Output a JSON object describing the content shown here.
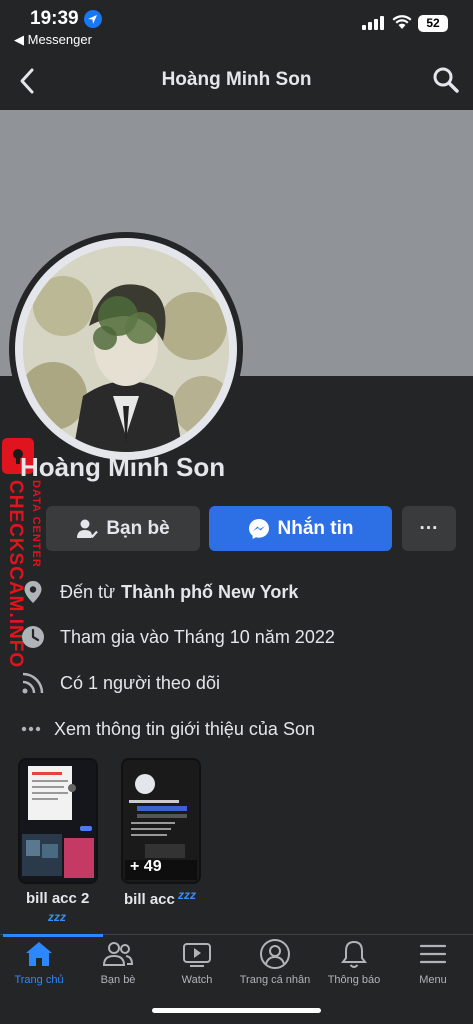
{
  "status_bar": {
    "time": "19:39",
    "back_app": "◀ Messenger",
    "battery": "52"
  },
  "nav": {
    "title": "Hoàng Minh Son"
  },
  "profile": {
    "name": "Hoàng Minh Son"
  },
  "watermark": {
    "brand": "CHECKSCAM.INFO",
    "sub": "DATA CENTER"
  },
  "actions": {
    "friends_label": "Bạn bè",
    "message_label": "Nhắn tin",
    "more_label": "···"
  },
  "info": {
    "location_prefix": "Đến từ",
    "location_city": "Thành phố New York",
    "joined": "Tham gia vào Tháng 10 năm 2022",
    "followers": "Có 1 người theo dõi",
    "about": "Xem thông tin giới thiệu của Son"
  },
  "stories": [
    {
      "label": "bill acc 2"
    },
    {
      "label": "bill acc",
      "count": "+ 49"
    }
  ],
  "zzz": "zzz",
  "tabs": [
    {
      "label": "Trang chủ",
      "icon": "home-icon"
    },
    {
      "label": "Bạn bè",
      "icon": "friends-icon"
    },
    {
      "label": "Watch",
      "icon": "watch-icon"
    },
    {
      "label": "Trang cá nhân",
      "icon": "profile-icon"
    },
    {
      "label": "Thông báo",
      "icon": "bell-icon"
    },
    {
      "label": "Menu",
      "icon": "menu-icon"
    }
  ],
  "colors": {
    "accent": "#2d88ff",
    "message_button": "#2d6fe4",
    "background": "#242526",
    "watermark": "#e0141e"
  }
}
